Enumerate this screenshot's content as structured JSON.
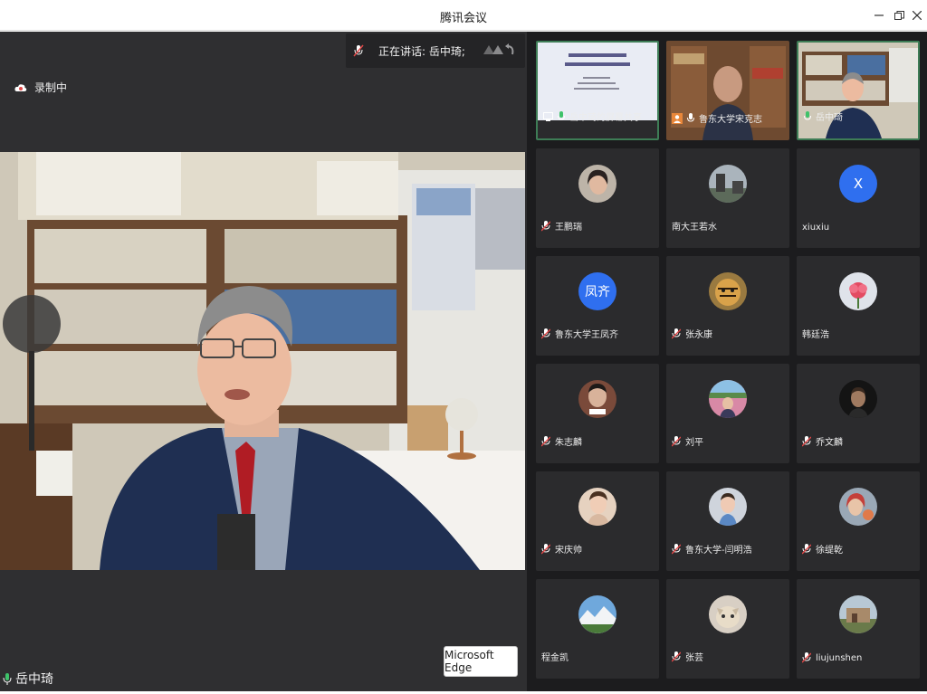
{
  "window": {
    "title": "腾讯会议"
  },
  "stage": {
    "speaking": "正在讲话: 岳中琦;",
    "recording": "录制中",
    "speaker_name": "岳中琦",
    "edge_button": "Microsoft Edge"
  },
  "gallery": {
    "tiles": [
      {
        "name": "岳中琦的屏幕共享",
        "kind": "screen"
      },
      {
        "name": "鲁东大学宋克志",
        "kind": "video"
      },
      {
        "name": "岳中琦",
        "kind": "video"
      },
      {
        "name": "王鹏瑞",
        "kind": "photo"
      },
      {
        "name": "南大王若水",
        "kind": "photo"
      },
      {
        "name": "xiuxiu",
        "kind": "letter",
        "letter": "X",
        "color": "#2f6fef"
      },
      {
        "name": "鲁东大学王凤齐",
        "kind": "letter",
        "letter": "凤齐",
        "color": "#2f6fef"
      },
      {
        "name": "张永康",
        "kind": "photo"
      },
      {
        "name": "韩廷浩",
        "kind": "photo"
      },
      {
        "name": "朱志麟",
        "kind": "photo"
      },
      {
        "name": "刘平",
        "kind": "photo"
      },
      {
        "name": "乔文麟",
        "kind": "photo"
      },
      {
        "name": "宋庆帅",
        "kind": "photo"
      },
      {
        "name": "鲁东大学-闫明浩",
        "kind": "photo"
      },
      {
        "name": "徐缇乾",
        "kind": "photo"
      },
      {
        "name": "程金凯",
        "kind": "photo"
      },
      {
        "name": "张芸",
        "kind": "photo"
      },
      {
        "name": "liujunshen",
        "kind": "photo"
      }
    ]
  }
}
